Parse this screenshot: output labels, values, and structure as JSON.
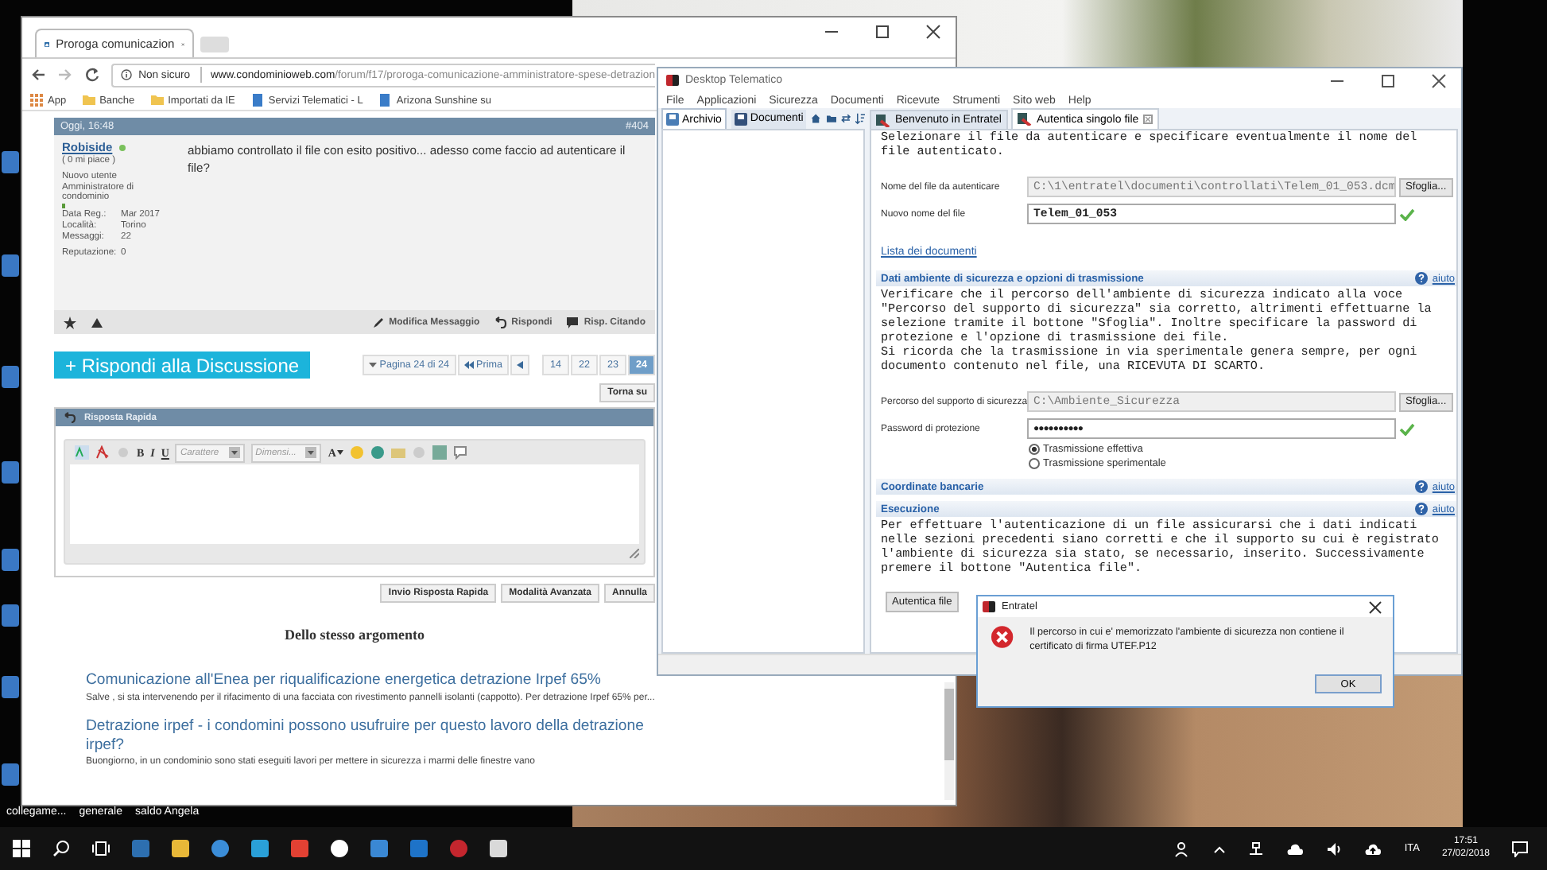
{
  "browser": {
    "tab_title": "Proroga comunicazion",
    "address_security": "Non sicuro",
    "url_domain": "www.condominioweb.com",
    "url_path": "/forum/f17/proroga-comunicazione-amministratore-spese-detrazion",
    "bookmarks": [
      {
        "kind": "apps",
        "label": "App"
      },
      {
        "kind": "folder",
        "label": "Banche"
      },
      {
        "kind": "folder",
        "label": "Importati da IE"
      },
      {
        "kind": "page",
        "label": "Servizi Telematici - L"
      },
      {
        "kind": "page",
        "label": "Arizona Sunshine su"
      }
    ],
    "post": {
      "date": "Oggi, 16:48",
      "number": "#404",
      "author": "Robiside",
      "online": true,
      "likes": "( 0 mi piace )",
      "rank": "Nuovo utente",
      "role": "Amministratore di condominio",
      "info": [
        {
          "label": "Data Reg.:",
          "value": "Mar 2017"
        },
        {
          "label": "Località:",
          "value": "Torino"
        },
        {
          "label": "Messaggi:",
          "value": "22"
        }
      ],
      "reputation_label": "Reputazione:",
      "reputation": "0",
      "text": "abbiamo controllato il file con esito positivo... adesso come faccio ad autenticare il file?",
      "actions": [
        {
          "kind": "edit",
          "label": "Modifica Messaggio"
        },
        {
          "kind": "reply",
          "label": "Rispondi"
        },
        {
          "kind": "quote",
          "label": "Risp. Citando"
        }
      ]
    },
    "reply_button": "+ Rispondi alla Discussione",
    "pagination": {
      "label": "Pagina 24 di 24",
      "first": "Prima",
      "pages": [
        {
          "label": "14",
          "selected": false
        },
        {
          "label": "22",
          "selected": false
        },
        {
          "label": "23",
          "selected": false
        },
        {
          "label": "24",
          "selected": true
        }
      ]
    },
    "top_button": "Torna su",
    "quick_reply": {
      "title": "Risposta Rapida",
      "format_buttons": [
        "B",
        "I",
        "U"
      ],
      "font_select": "Carattere",
      "size_select": "Dimensi...",
      "color_button": "A",
      "buttons": [
        "Invio Risposta Rapida",
        "Modalità Avanzata",
        "Annulla"
      ]
    },
    "related": {
      "title": "Dello stesso argomento",
      "items": [
        {
          "title": "Comunicazione all'Enea per riqualificazione energetica detrazione Irpef 65%",
          "excerpt": "Salve , si sta intervenendo per il rifacimento di una facciata con rivestimento pannelli isolanti (cappotto). Per detrazione Irpef 65% per..."
        },
        {
          "title": "Detrazione irpef - i condomini possono usufruire per questo lavoro della detrazione irpef?",
          "excerpt": "Buongiorno, in un condominio sono stati eseguiti lavori per mettere in sicurezza i marmi delle finestre vano"
        }
      ]
    }
  },
  "telematico": {
    "title": "Desktop Telematico",
    "menu": [
      "File",
      "Applicazioni",
      "Sicurezza",
      "Documenti",
      "Ricevute",
      "Strumenti",
      "Sito web",
      "Help"
    ],
    "left_tabs": [
      {
        "label": "Archivio",
        "selected": true
      },
      {
        "label": "Documenti",
        "selected": false
      }
    ],
    "tabs": [
      {
        "label": "Benvenuto in Entratel",
        "selected": false
      },
      {
        "label": "Autentica singolo file",
        "selected": true
      }
    ],
    "intro": "Selezionare il file da autenticare e specificare eventualmente il nome del file autenticato.",
    "fields": [
      {
        "label": "Nome del file da autenticare",
        "value": "C:\\1\\entratel\\documenti\\controllati\\Telem_01_053.dcm",
        "disabled": true,
        "valid": false,
        "button": "Sfoglia..."
      },
      {
        "label": "Nuovo nome del file",
        "value": "Telem_01_053",
        "disabled": false,
        "valid": true
      }
    ],
    "doc_link": "Lista dei documenti",
    "sections": [
      {
        "title": "Dati ambiente di sicurezza e opzioni di trasmissione",
        "help": "aiuto",
        "paragraphs": [
          "Verificare che il percorso dell'ambiente di sicurezza indicato alla voce \"Percorso del supporto di sicurezza\" sia corretto, altrimenti effettuarne la selezione tramite il bottone \"Sfoglia\". Inoltre specificare la password di protezione e l'opzione di trasmissione dei file.",
          "Si ricorda che la trasmissione in via sperimentale genera sempre, per ogni documento contenuto nel file, una RICEVUTA DI SCARTO."
        ],
        "fields": [
          {
            "label": "Percorso del supporto di sicurezza",
            "value": "C:\\Ambiente_Sicurezza",
            "disabled": true,
            "valid": false,
            "button": "Sfoglia..."
          },
          {
            "label": "Password di protezione",
            "value": "●●●●●●●●●●",
            "disabled": false,
            "valid": true
          }
        ],
        "radios": [
          {
            "label": "Trasmissione effettiva",
            "selected": true
          },
          {
            "label": "Trasmissione sperimentale",
            "selected": false
          }
        ]
      },
      {
        "title": "Coordinate bancarie",
        "help": "aiuto"
      },
      {
        "title": "Esecuzione",
        "help": "aiuto",
        "paragraphs": [
          "Per effettuare l'autenticazione di un file assicurarsi che i dati indicati nelle sezioni precedenti siano corretti e che il supporto su cui è registrato l'ambiente di sicurezza sia stato, se necessario, inserito. Successivamente premere il bottone \"Autentica file\"."
        ],
        "button": "Autentica file"
      }
    ]
  },
  "dialog": {
    "title": "Entratel",
    "message": "Il percorso in cui e' memorizzato l'ambiente di sicurezza non contiene il certificato di firma UTEF.P12",
    "button": "OK"
  },
  "desktop": {
    "labels": [
      "collegame...",
      "generale",
      "saldo Angela"
    ]
  },
  "taskbar": {
    "language": "ITA",
    "time": "17:51",
    "date": "27/02/2018"
  }
}
